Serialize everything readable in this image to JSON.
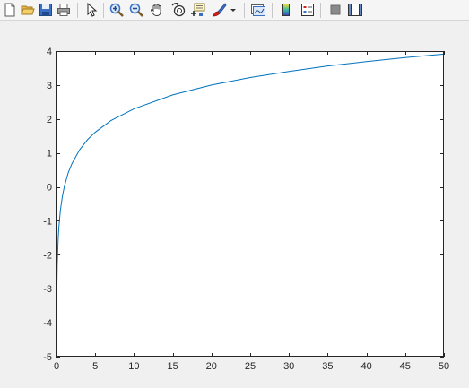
{
  "toolbar": {
    "items": [
      {
        "name": "new-figure-icon"
      },
      {
        "name": "open-file-icon"
      },
      {
        "name": "save-icon"
      },
      {
        "name": "print-icon"
      },
      {
        "name": "arrow-pointer-icon"
      },
      {
        "name": "zoom-in-icon"
      },
      {
        "name": "zoom-out-icon"
      },
      {
        "name": "pan-hand-icon"
      },
      {
        "name": "rotate-3d-icon"
      },
      {
        "name": "data-cursor-icon"
      },
      {
        "name": "brush-icon"
      },
      {
        "name": "brush-dropdown-icon"
      },
      {
        "name": "link-plot-icon"
      },
      {
        "name": "colorbar-icon"
      },
      {
        "name": "legend-icon"
      },
      {
        "name": "hide-plot-tools-icon"
      },
      {
        "name": "show-plot-tools-icon"
      }
    ]
  },
  "chart_data": {
    "type": "line",
    "title": "",
    "xlabel": "",
    "ylabel": "",
    "xlim": [
      0,
      50
    ],
    "ylim": [
      -5,
      4
    ],
    "xticks": [
      "0",
      "5",
      "10",
      "15",
      "20",
      "25",
      "30",
      "35",
      "40",
      "45",
      "50"
    ],
    "yticks": [
      "-5",
      "-4",
      "-3",
      "-2",
      "-1",
      "0",
      "1",
      "2",
      "3",
      "4"
    ],
    "grid": false,
    "series": [
      {
        "color": "#0072bd",
        "x": [
          0.01,
          0.05,
          0.1,
          0.2,
          0.3,
          0.5,
          0.75,
          1,
          1.5,
          2,
          3,
          4,
          5,
          7,
          10,
          15,
          20,
          25,
          30,
          35,
          40,
          45,
          50
        ],
        "y": [
          -4.61,
          -3.0,
          -2.3,
          -1.61,
          -1.2,
          -0.69,
          -0.29,
          0.0,
          0.41,
          0.69,
          1.1,
          1.39,
          1.61,
          1.95,
          2.3,
          2.71,
          3.0,
          3.22,
          3.4,
          3.56,
          3.69,
          3.81,
          3.91
        ]
      }
    ]
  }
}
